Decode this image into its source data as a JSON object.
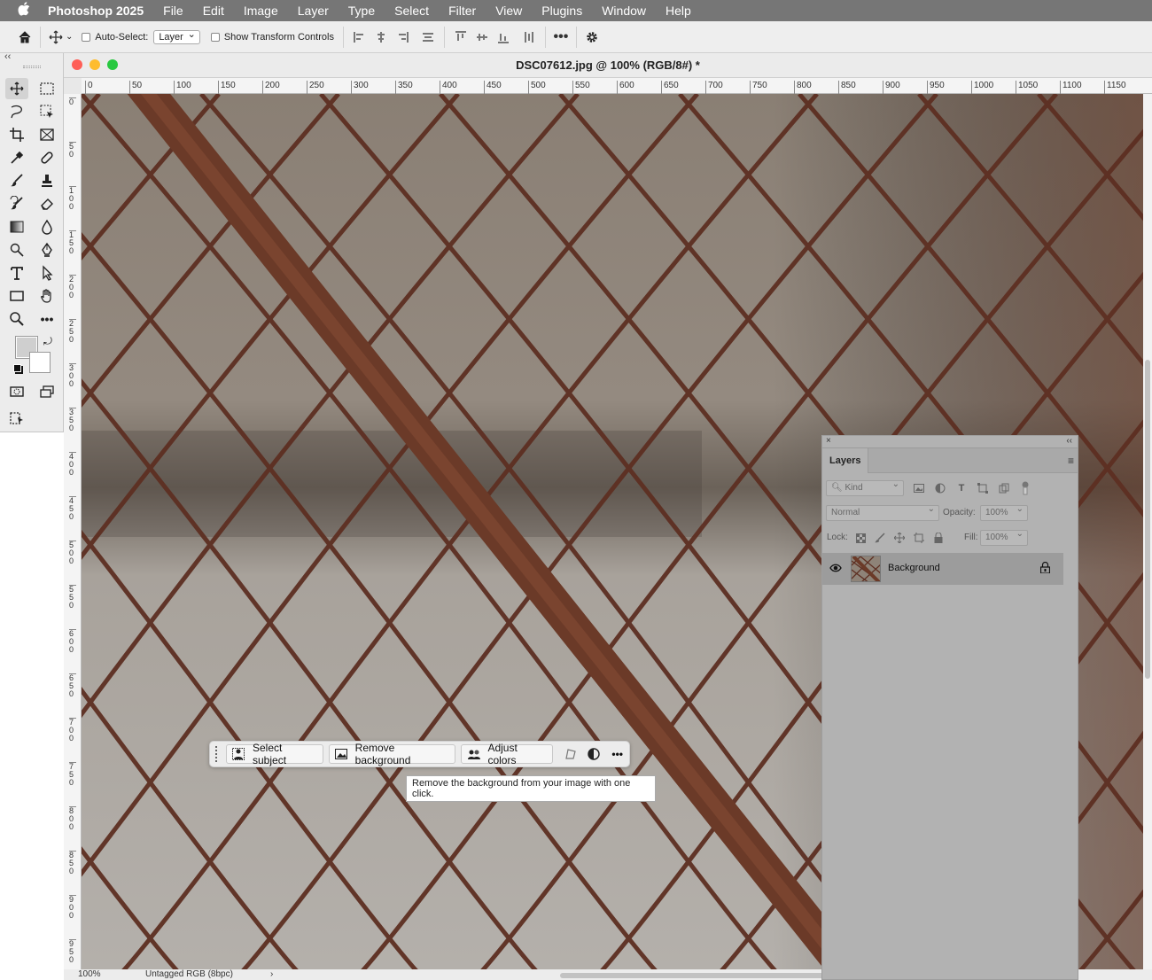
{
  "menubar": {
    "app_name": "Photoshop 2025",
    "items": [
      "File",
      "Edit",
      "Image",
      "Layer",
      "Type",
      "Select",
      "Filter",
      "View",
      "Plugins",
      "Window",
      "Help"
    ]
  },
  "options_bar": {
    "auto_select_label": "Auto-Select:",
    "auto_select_value": "Layer",
    "show_transform_label": "Show Transform Controls"
  },
  "document": {
    "title": "DSC07612.jpg @ 100% (RGB/8#) *",
    "ruler_h": [
      "0",
      "50",
      "100",
      "150",
      "200",
      "250",
      "300",
      "350",
      "400",
      "450",
      "500",
      "550",
      "600",
      "650",
      "700",
      "750",
      "800",
      "850",
      "900",
      "950",
      "1000",
      "1050",
      "1100",
      "1150"
    ],
    "ruler_v": [
      "0",
      "50",
      "100",
      "150",
      "200",
      "250",
      "300",
      "350",
      "400",
      "450",
      "500",
      "550",
      "600",
      "650",
      "700",
      "750",
      "800",
      "850",
      "900",
      "950"
    ]
  },
  "status": {
    "zoom": "100%",
    "profile": "Untagged RGB (8bpc)",
    "arrow": "›"
  },
  "taskbar": {
    "select_subject": "Select subject",
    "remove_background": "Remove background",
    "adjust_colors": "Adjust colors",
    "tooltip": "Remove the background from your image with one click."
  },
  "layers_panel": {
    "close": "×",
    "collapse": "‹‹",
    "tab": "Layers",
    "kind": "Kind",
    "blend_mode": "Normal",
    "opacity_label": "Opacity:",
    "opacity_value": "100%",
    "lock_label": "Lock:",
    "fill_label": "Fill:",
    "fill_value": "100%",
    "layers": [
      {
        "name": "Background",
        "visible": true,
        "locked": true
      }
    ]
  },
  "colors": {
    "foreground": "#cfcfcf",
    "background": "#ffffff",
    "close_light": "#fe5f57",
    "minimize_light": "#febc2e",
    "zoom_light": "#28c840"
  }
}
